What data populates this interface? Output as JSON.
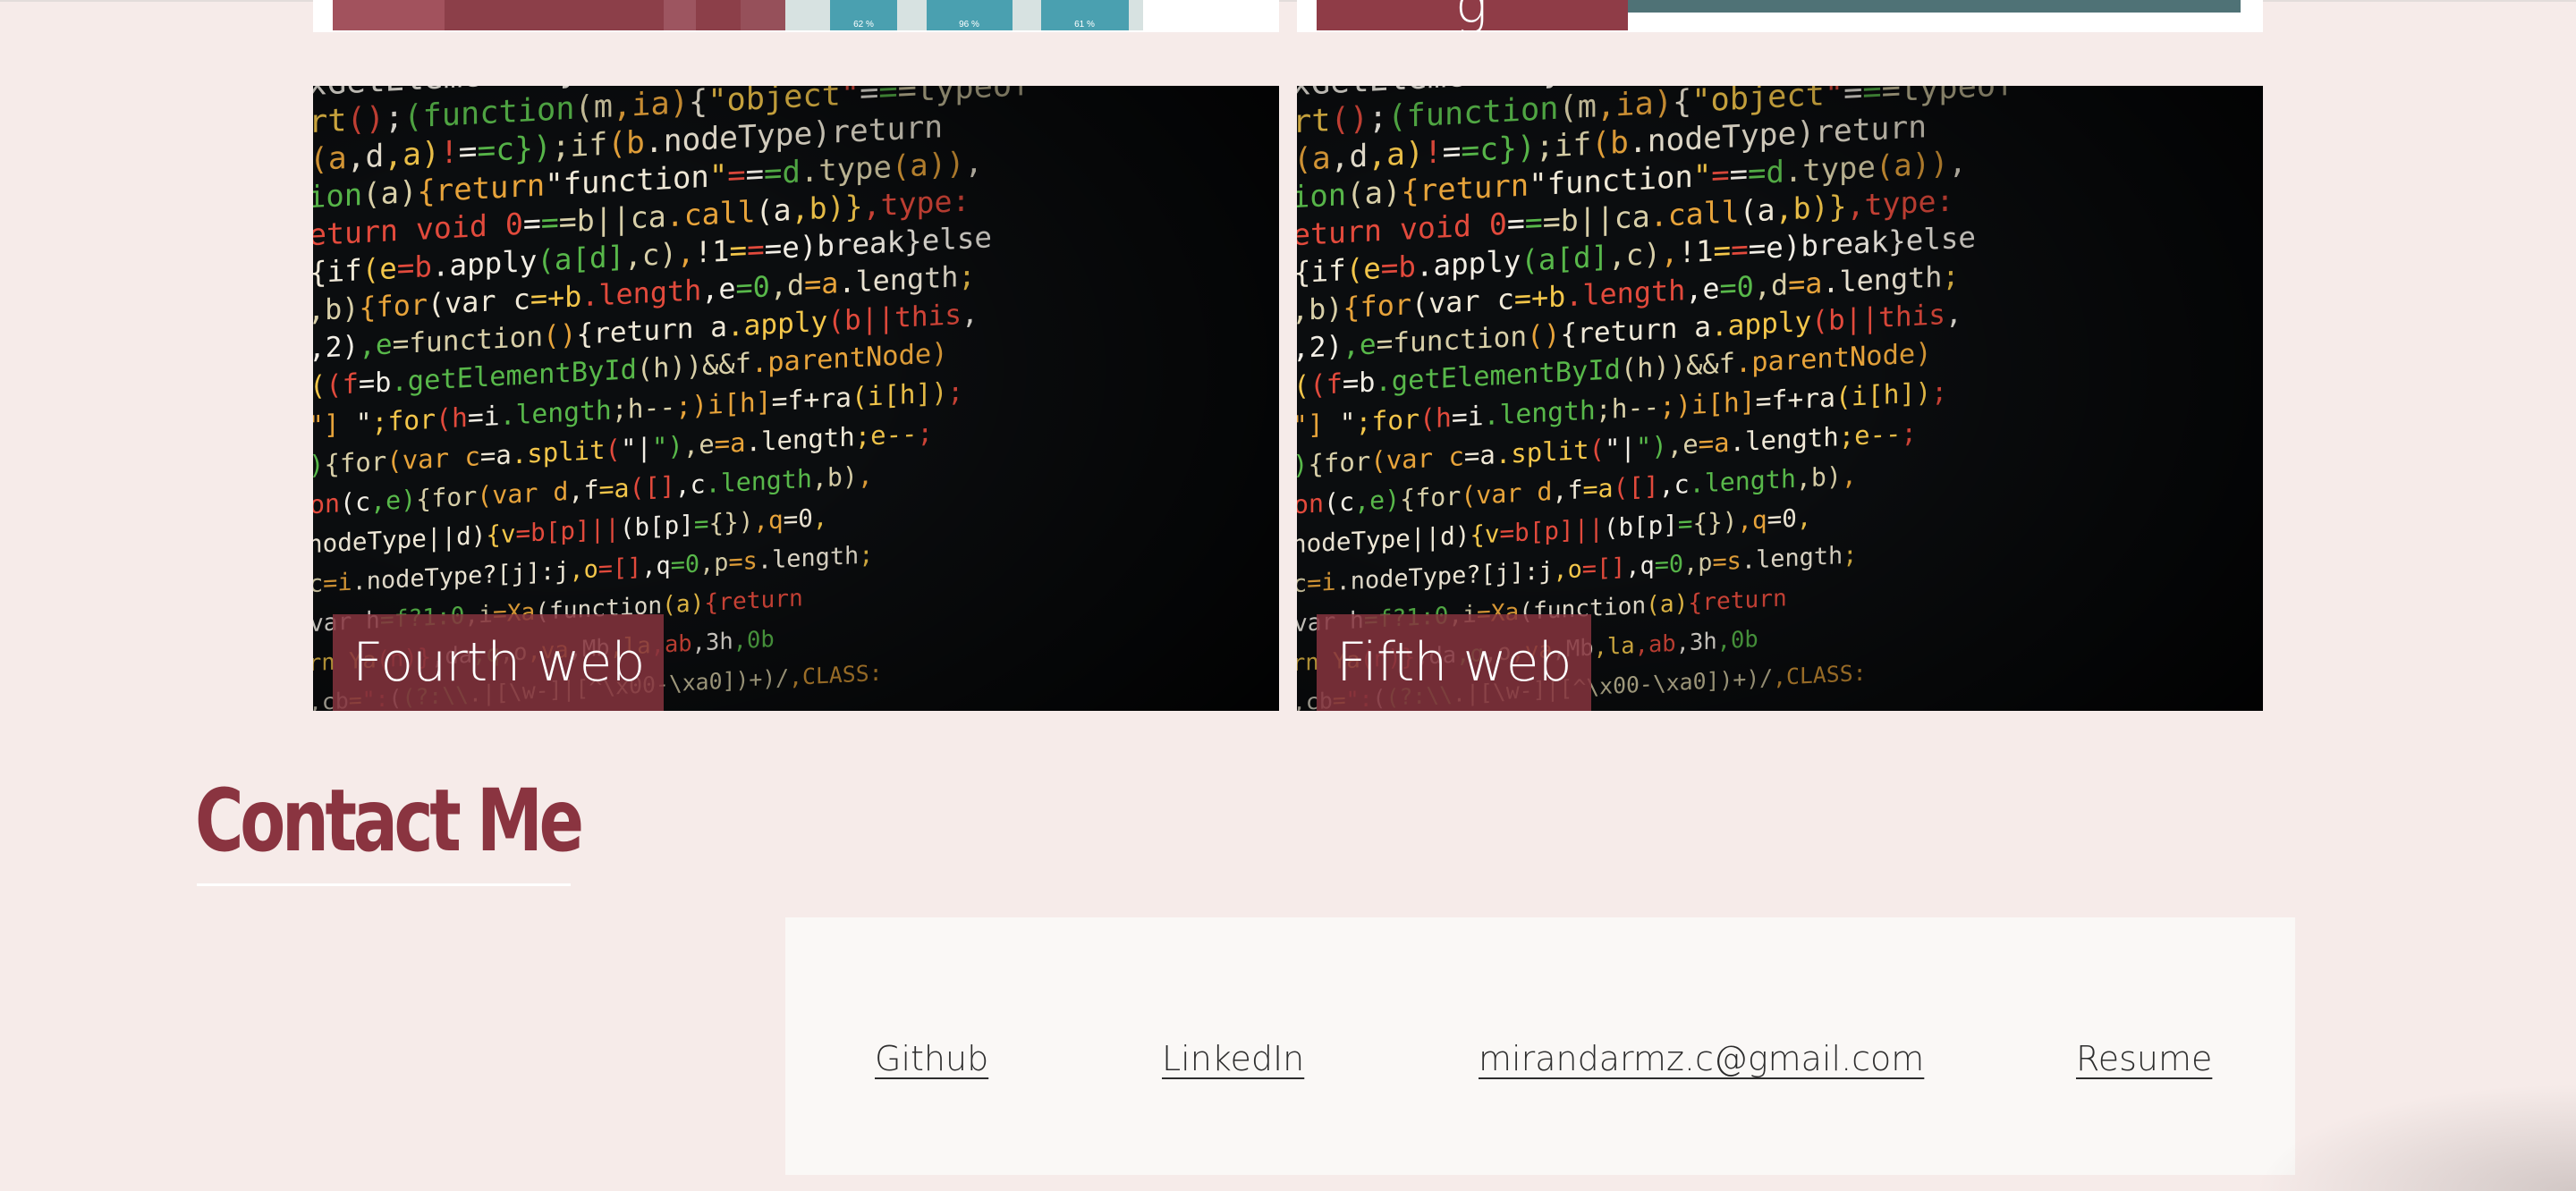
{
  "colors": {
    "page_bg": "#f6ebe9",
    "accent": "#8a3440",
    "label_bg": "#86343e",
    "contact_bg": "#faf8f6"
  },
  "top_partial_cards": {
    "left": {
      "bar_labels": [
        "62 %",
        "96 %",
        "61 %"
      ]
    },
    "right": {
      "label_fragment": "g"
    }
  },
  "projects": [
    {
      "label": "Fourth web",
      "image": "code-screenshot"
    },
    {
      "label": "Fifth web",
      "image": "code-screenshot"
    }
  ],
  "contact": {
    "heading": "Contact Me",
    "links": [
      {
        "label": "Github"
      },
      {
        "label": "LinkedIn"
      },
      {
        "label": "mirandarmz.c@gmail.com"
      },
      {
        "label": "Resume"
      }
    ]
  }
}
